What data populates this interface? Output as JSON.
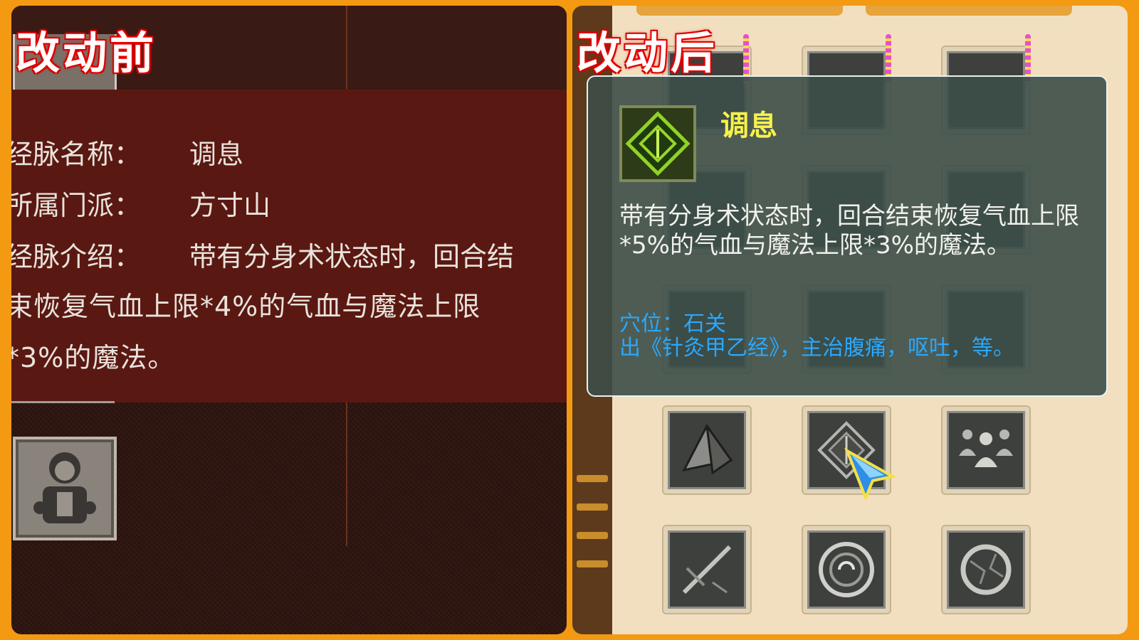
{
  "before": {
    "title": "改动前",
    "labels": {
      "name": "经脉名称：",
      "sect": "所属门派：",
      "intro": "经脉介绍："
    },
    "values": {
      "name": "调息",
      "sect": "方寸山"
    },
    "description_lines": [
      "带有分身术状态时，回合结",
      "束恢复气血上限*4%的气血与魔法上限",
      "*3%的魔法。"
    ]
  },
  "after": {
    "title": "改动后",
    "tooltip": {
      "name": "调息",
      "description": "带有分身术状态时，回合结束恢复气血上限*5%的气血与魔法上限*3%的魔法。",
      "acupoint": "穴位：石关",
      "acupoint_info": "出《针灸甲乙经》，主治腹痛，呕吐，等。"
    },
    "icons": [
      "diamond-sigil-icon",
      "pyramid-icon",
      "active-diamond-icon",
      "meditating-monks-icon",
      "broken-sword-icon",
      "spiral-medallion-icon",
      "cracked-circle-icon"
    ]
  },
  "colors": {
    "frame_orange": "#f39a12",
    "title_glow_red": "#ff0000",
    "tooltip_name_yellow": "#f7f24a",
    "acupoint_blue": "#29a8ff"
  }
}
